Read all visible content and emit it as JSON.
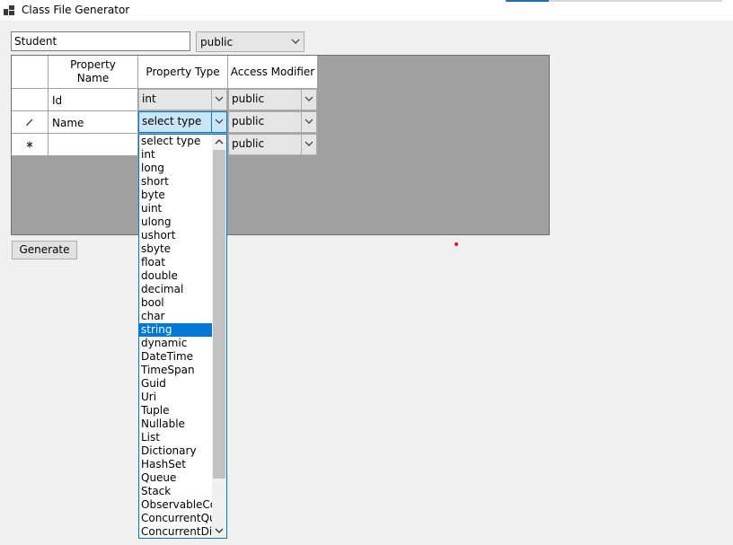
{
  "window": {
    "title": "Class File Generator"
  },
  "form": {
    "class_name": "Student",
    "class_access": "public",
    "generate_label": "Generate"
  },
  "grid": {
    "headers": [
      "Property Name",
      "Property Type",
      "Access Modifier"
    ],
    "rows": [
      {
        "name": "Id",
        "type": "int",
        "access": "public"
      },
      {
        "name": "Name",
        "type": "select type",
        "access": "public",
        "editing": true
      },
      {
        "name": "",
        "type": "",
        "access": "public",
        "new_row": true
      }
    ]
  },
  "dropdown": {
    "selected": "string",
    "items": [
      "select type",
      "int",
      "long",
      "short",
      "byte",
      "uint",
      "ulong",
      "ushort",
      "sbyte",
      "float",
      "double",
      "decimal",
      "bool",
      "char",
      "string",
      "dynamic",
      "DateTime",
      "TimeSpan",
      "Guid",
      "Uri",
      "Tuple",
      "Nullable",
      "List",
      "Dictionary",
      "HashSet",
      "Queue",
      "Stack",
      "ObservableCol",
      "ConcurrentQu",
      "ConcurrentDic"
    ]
  },
  "colors": {
    "accent": "#0078d7",
    "grid_background": "#a0a0a0",
    "selection": "#0078d7"
  },
  "icons": [
    "app-icon",
    "pencil-icon",
    "asterisk-icon",
    "chevron-down-icon",
    "scroll-up-icon",
    "scroll-down-icon"
  ]
}
